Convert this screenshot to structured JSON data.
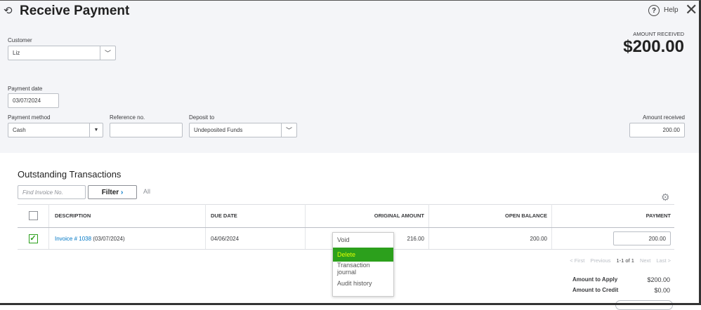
{
  "header": {
    "title": "Receive Payment",
    "help": "Help"
  },
  "amount_received": {
    "label": "AMOUNT RECEIVED",
    "value": "$200.00"
  },
  "form": {
    "customer": {
      "label": "Customer",
      "value": "Liz"
    },
    "payment_date": {
      "label": "Payment date",
      "value": "03/07/2024"
    },
    "payment_method": {
      "label": "Payment method",
      "value": "Cash"
    },
    "reference": {
      "label": "Reference no.",
      "value": ""
    },
    "deposit_to": {
      "label": "Deposit to",
      "value": "Undeposited Funds"
    },
    "amount": {
      "label": "Amount received",
      "value": "200.00"
    }
  },
  "outstanding": {
    "title": "Outstanding Transactions",
    "find_placeholder": "Find Invoice No.",
    "filter": "Filter",
    "all": "All",
    "columns": [
      "DESCRIPTION",
      "DUE DATE",
      "ORIGINAL AMOUNT",
      "OPEN BALANCE",
      "PAYMENT"
    ],
    "row": {
      "invoice": "Invoice # 1038",
      "date": "(03/07/2024)",
      "due": "04/06/2024",
      "original": "216.00",
      "open": "200.00",
      "payment": "200.00",
      "checked": true
    }
  },
  "pagination": {
    "first": "< First",
    "previous": "Previous",
    "range": "1-1 of 1",
    "next": "Next",
    "last": "Last >"
  },
  "totals": {
    "apply_label": "Amount to Apply",
    "apply": "$200.00",
    "credit_label": "Amount to Credit",
    "credit": "$0.00"
  },
  "context_menu": [
    "Void",
    "Delete",
    "Transaction journal",
    "Audit history"
  ]
}
